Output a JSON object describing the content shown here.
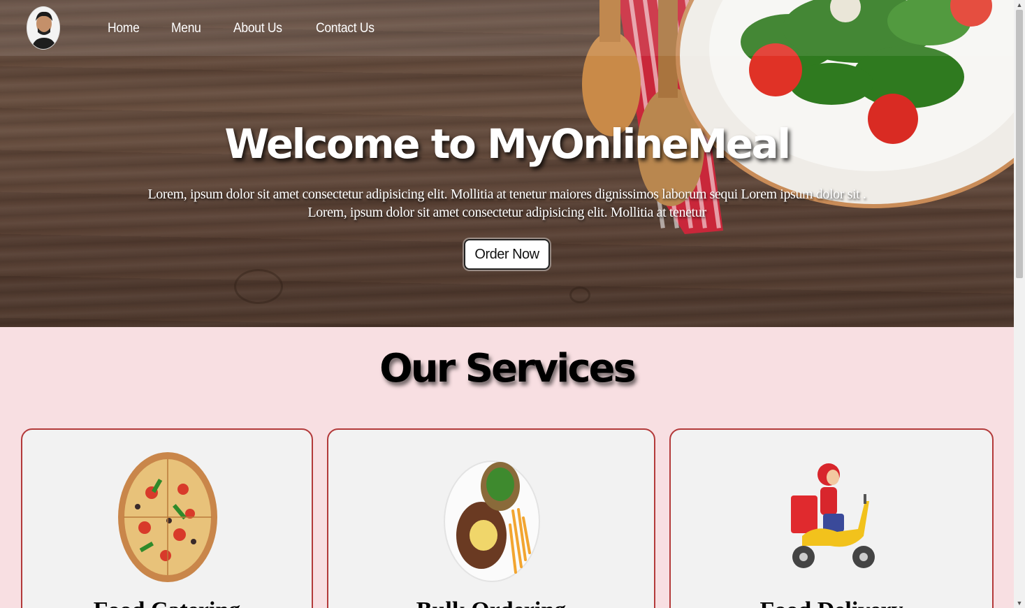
{
  "nav": {
    "links": [
      "Home",
      "Menu",
      "About Us",
      "Contact Us"
    ]
  },
  "hero": {
    "title": "Welcome to MyOnlineMeal",
    "subtitle_line1": "Lorem, ipsum dolor sit amet consectetur adipisicing elit. Mollitia at tenetur maiores dignissimos laborum sequi Lorem ipsum dolor sit .",
    "subtitle_line2": "Lorem, ipsum dolor sit amet consectetur adipisicing elit. Mollitia at tenetur",
    "order_button": "Order Now"
  },
  "services": {
    "title": "Our Services",
    "cards": [
      {
        "title": "Food Catering",
        "image": "pizza"
      },
      {
        "title": "Bulk Ordering",
        "image": "steak-plate"
      },
      {
        "title": "Food Delivery",
        "image": "delivery-scooter"
      }
    ]
  },
  "colors": {
    "section_bg": "#f8dfe2",
    "card_border": "#b33a3a",
    "card_bg": "#f2f2f2"
  }
}
